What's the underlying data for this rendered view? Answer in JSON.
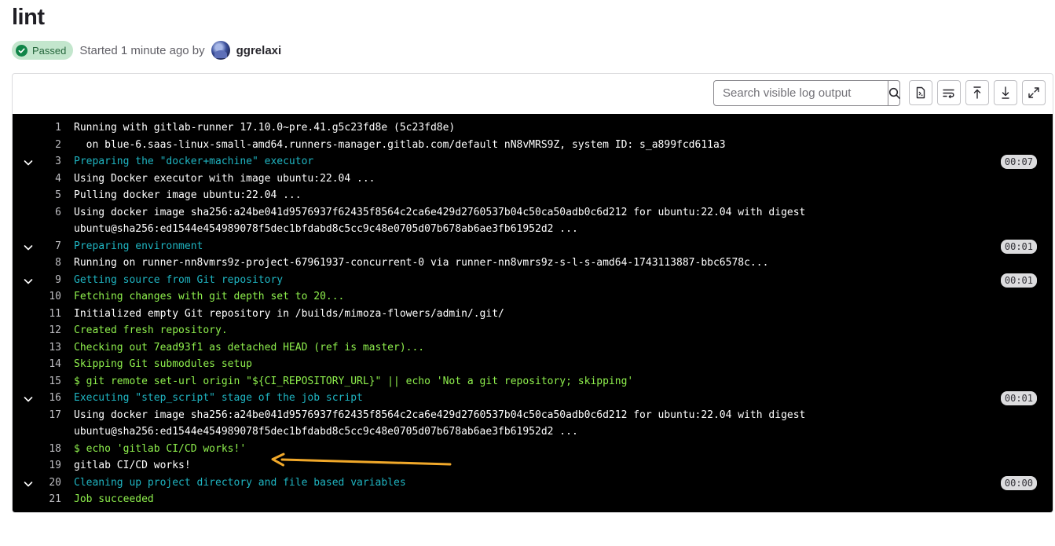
{
  "job": {
    "title": "lint",
    "status": "Passed",
    "started": "Started 1 minute ago by",
    "user": "ggrelaxi",
    "status_color": "#108548"
  },
  "toolbar": {
    "search_placeholder": "Search visible log output",
    "buttons": [
      "search-icon",
      "raw-log-icon",
      "wrap-lines-icon",
      "scroll-top-icon",
      "scroll-bottom-icon",
      "fullscreen-icon"
    ]
  },
  "log": {
    "lines": [
      {
        "n": "1",
        "text": "Running with gitlab-runner 17.10.0~pre.41.g5c23fd8e (5c23fd8e)",
        "style": "plain"
      },
      {
        "n": "2",
        "text": "  on blue-6.saas-linux-small-amd64.runners-manager.gitlab.com/default nN8vMRS9Z, system ID: s_a899fcd611a3",
        "style": "plain"
      },
      {
        "n": "3",
        "text": "Preparing the \"docker+machine\" executor",
        "style": "cyan",
        "section": true,
        "dur": "00:07"
      },
      {
        "n": "4",
        "text": "Using Docker executor with image ubuntu:22.04 ...",
        "style": "plain"
      },
      {
        "n": "5",
        "text": "Pulling docker image ubuntu:22.04 ...",
        "style": "plain"
      },
      {
        "n": "6",
        "text": "Using docker image sha256:a24be041d9576937f62435f8564c2ca6e429d2760537b04c50ca50adb0c6d212 for ubuntu:22.04 with digest ubuntu@sha256:ed1544e454989078f5dec1bfdabd8c5cc9c48e0705d07b678ab6ae3fb61952d2 ...",
        "style": "plain",
        "tall": true
      },
      {
        "n": "7",
        "text": "Preparing environment",
        "style": "cyan",
        "section": true,
        "dur": "00:01"
      },
      {
        "n": "8",
        "text": "Running on runner-nn8vmrs9z-project-67961937-concurrent-0 via runner-nn8vmrs9z-s-l-s-amd64-1743113887-bbc6578c...",
        "style": "plain"
      },
      {
        "n": "9",
        "text": "Getting source from Git repository",
        "style": "cyan",
        "section": true,
        "dur": "00:01"
      },
      {
        "n": "10",
        "text": "Fetching changes with git depth set to 20...",
        "style": "green"
      },
      {
        "n": "11",
        "text": "Initialized empty Git repository in /builds/mimoza-flowers/admin/.git/",
        "style": "plain"
      },
      {
        "n": "12",
        "text": "Created fresh repository.",
        "style": "green"
      },
      {
        "n": "13",
        "text": "Checking out 7ead93f1 as detached HEAD (ref is master)...",
        "style": "green"
      },
      {
        "n": "14",
        "text": "Skipping Git submodules setup",
        "style": "green"
      },
      {
        "n": "15",
        "text": "$ git remote set-url origin \"${CI_REPOSITORY_URL}\" || echo 'Not a git repository; skipping'",
        "style": "green"
      },
      {
        "n": "16",
        "text": "Executing \"step_script\" stage of the job script",
        "style": "cyan",
        "section": true,
        "dur": "00:01"
      },
      {
        "n": "17",
        "text": "Using docker image sha256:a24be041d9576937f62435f8564c2ca6e429d2760537b04c50ca50adb0c6d212 for ubuntu:22.04 with digest ubuntu@sha256:ed1544e454989078f5dec1bfdabd8c5cc9c48e0705d07b678ab6ae3fb61952d2 ...",
        "style": "plain",
        "tall": true
      },
      {
        "n": "18",
        "text": "$ echo 'gitlab CI/CD works!'",
        "style": "green"
      },
      {
        "n": "19",
        "text": "gitlab CI/CD works!",
        "style": "plain"
      },
      {
        "n": "20",
        "text": "Cleaning up project directory and file based variables",
        "style": "cyan",
        "section": true,
        "dur": "00:00"
      },
      {
        "n": "21",
        "text": "Job succeeded",
        "style": "green"
      }
    ],
    "colors": {
      "section": "#1fb5c2",
      "success": "#8ff04d",
      "annotation_arrow": "#f0a82a"
    }
  }
}
